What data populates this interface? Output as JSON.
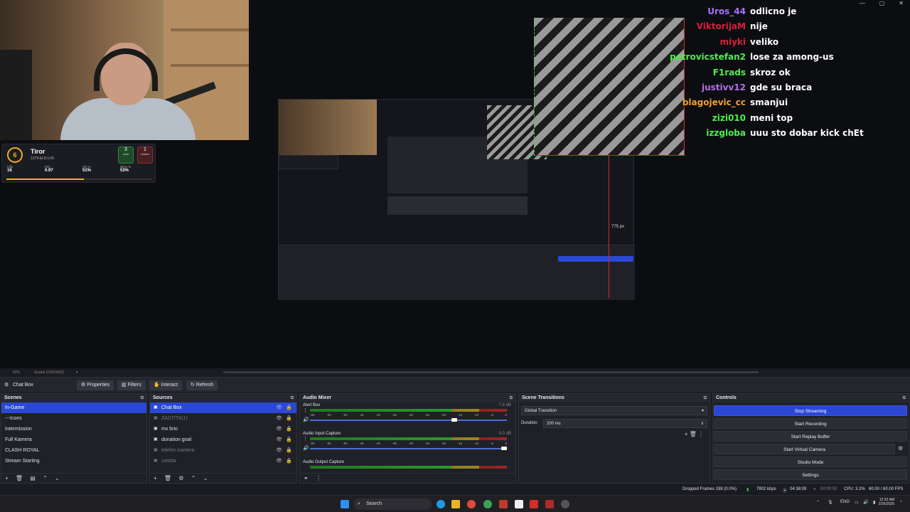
{
  "window": {
    "controls": [
      "—",
      "▢",
      "✕"
    ]
  },
  "faceit": {
    "level": "6",
    "name": "Tiror",
    "elo": "1279 ELO (+0)",
    "wins": "3",
    "wins_label": "wins",
    "losses": "1",
    "losses_label": "losses",
    "stats": [
      {
        "label": "Kills",
        "value": "16"
      },
      {
        "label": "K/D",
        "value": "0.97"
      },
      {
        "label": "HS %",
        "value": "51%"
      },
      {
        "label": "Wins %",
        "value": "53%"
      }
    ]
  },
  "chat": [
    {
      "user": "Uros_44",
      "msg": "odlicno je",
      "color": "#a970ff"
    },
    {
      "user": "ViktorijaM",
      "msg": "nije",
      "color": "#d41f3a"
    },
    {
      "user": "miyki",
      "msg": "veliko",
      "color": "#d41f3a"
    },
    {
      "user": "petrovicstefan2",
      "msg": "lose za among-us",
      "color": "#4cf04c"
    },
    {
      "user": "F1rads",
      "msg": "skroz ok",
      "color": "#4cf04c"
    },
    {
      "user": "justivv12",
      "msg": "gde su braca",
      "color": "#b86cf0"
    },
    {
      "user": "blagojevic_cc",
      "msg": "smanjui",
      "color": "#f0a02a"
    },
    {
      "user": "zizi010",
      "msg": "meni top",
      "color": "#4cf04c"
    },
    {
      "user": "izzgloba",
      "msg": "uuu sto dobar kick chEt",
      "color": "#4cf04c"
    }
  ],
  "preview": {
    "size_label": "775 px"
  },
  "zoom": {
    "level": "52%",
    "scaled": "Scaled (1002x563)"
  },
  "toolbar": {
    "source_name": "Chat Box",
    "properties": "Properties",
    "filters": "Filters",
    "interact": "Interact",
    "refresh": "Refresh"
  },
  "scenes": {
    "title": "Scenes",
    "items": [
      {
        "label": "In-Game",
        "selected": true
      },
      {
        "label": "---Icons"
      },
      {
        "label": "Intermission"
      },
      {
        "label": "Full Kamera"
      },
      {
        "label": "CLASH ROYAL"
      },
      {
        "label": "Stream Starting"
      }
    ]
  },
  "sources": {
    "title": "Sources",
    "items": [
      {
        "label": "Chat Box",
        "selected": true
      },
      {
        "label": "ZASTITA(1)",
        "dim": true
      },
      {
        "label": "mx brio"
      },
      {
        "label": "donation goal"
      },
      {
        "label": "telefon kamera",
        "dim": true
      },
      {
        "label": "zastita",
        "dim": true
      }
    ]
  },
  "mixer": {
    "title": "Audio Mixer",
    "tracks": [
      {
        "name": "Alert Box",
        "db": "-7.8 dB",
        "level": 0.74
      },
      {
        "name": "Audio Input Capture",
        "db": "0.0 dB",
        "level": 1.0
      },
      {
        "name": "Audio Output Capture",
        "db": "",
        "level": 1.0
      }
    ],
    "scale": [
      "-60",
      "-55",
      "-50",
      "-45",
      "-40",
      "-35",
      "-30",
      "-25",
      "-20",
      "-15",
      "-10",
      "-5",
      "0"
    ]
  },
  "transitions": {
    "title": "Scene Transitions",
    "selected": "Global Transition",
    "duration_label": "Duration",
    "duration": "200 ms"
  },
  "controls": {
    "title": "Controls",
    "buttons": [
      "Stop Streaming",
      "Start Recording",
      "Start Replay Buffer",
      "Start Virtual Camera",
      "Studio Mode",
      "Settings"
    ]
  },
  "status": {
    "dropped": "Dropped Frames 198 (0.0%)",
    "bitrate": "7802 kbps",
    "stream_time": "04:38:09",
    "rec_time": "00:00:00",
    "cpu": "CPU: 3.2%",
    "fps": "60.00 / 60.00 FPS"
  },
  "taskbar": {
    "search": "Search",
    "lang": "ENG",
    "time": "12:32 AM",
    "date": "2/26/2026"
  }
}
